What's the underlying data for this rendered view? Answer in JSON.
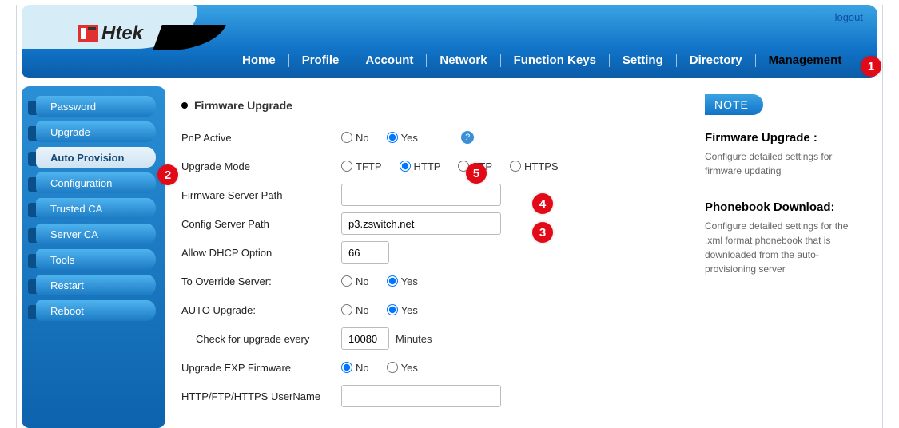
{
  "logout_label": "logout",
  "brand": "Htek",
  "nav": {
    "items": [
      {
        "label": "Home",
        "active": false
      },
      {
        "label": "Profile",
        "active": false
      },
      {
        "label": "Account",
        "active": false
      },
      {
        "label": "Network",
        "active": false
      },
      {
        "label": "Function Keys",
        "active": false
      },
      {
        "label": "Setting",
        "active": false
      },
      {
        "label": "Directory",
        "active": false
      },
      {
        "label": "Management",
        "active": true
      }
    ]
  },
  "sidebar": {
    "items": [
      {
        "label": "Password",
        "active": false
      },
      {
        "label": "Upgrade",
        "active": false
      },
      {
        "label": "Auto Provision",
        "active": true
      },
      {
        "label": "Configuration",
        "active": false
      },
      {
        "label": "Trusted CA",
        "active": false
      },
      {
        "label": "Server CA",
        "active": false
      },
      {
        "label": "Tools",
        "active": false
      },
      {
        "label": "Restart",
        "active": false
      },
      {
        "label": "Reboot",
        "active": false
      }
    ]
  },
  "section_title": "Firmware Upgrade",
  "labels": {
    "pnp_active": "PnP Active",
    "upgrade_mode": "Upgrade Mode",
    "fw_server_path": "Firmware Server Path",
    "cfg_server_path": "Config Server Path",
    "allow_dhcp": "Allow DHCP Option",
    "override": "To Override Server:",
    "auto_upgrade": "AUTO Upgrade:",
    "check_every": "Check for upgrade every",
    "minutes": "Minutes",
    "upgrade_exp": "Upgrade EXP Firmware",
    "httpuser": "HTTP/FTP/HTTPS UserName",
    "no": "No",
    "yes": "Yes"
  },
  "upgrade_modes": [
    "TFTP",
    "HTTP",
    "FTP",
    "HTTPS"
  ],
  "values": {
    "pnp_active": "Yes",
    "upgrade_mode": "HTTP",
    "fw_server_path": "",
    "cfg_server_path": "p3.zswitch.net",
    "allow_dhcp": "66",
    "override": "Yes",
    "auto_upgrade": "Yes",
    "check_every": "10080",
    "upgrade_exp": "No",
    "http_user": ""
  },
  "note": {
    "badge": "NOTE",
    "h1": "Firmware Upgrade :",
    "p1": "Configure detailed settings for firmware updating",
    "h2": "Phonebook Download:",
    "p2": "Configure detailed settings for the .xml format phonebook that is downloaded from the auto-provisioning server"
  },
  "callouts": {
    "1": "1",
    "2": "2",
    "3": "3",
    "4": "4",
    "5": "5"
  }
}
